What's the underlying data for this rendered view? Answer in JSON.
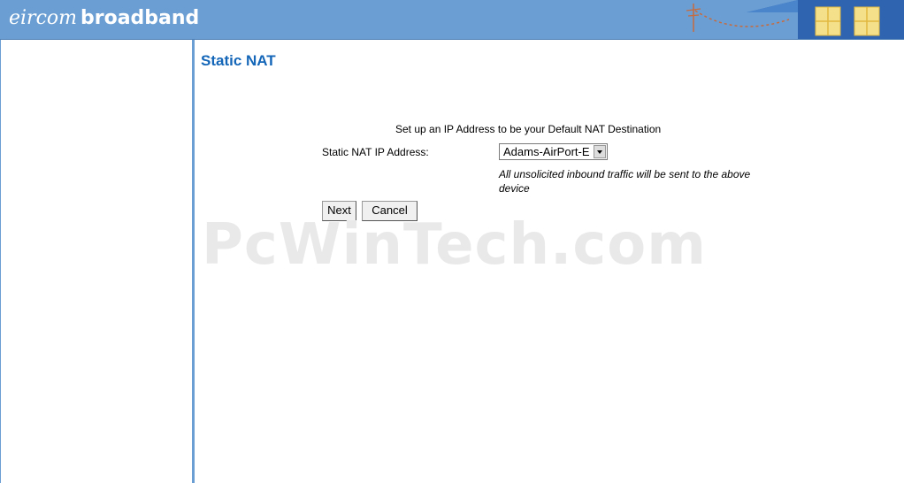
{
  "header": {
    "brand_part1": "eircom",
    "brand_part2": "broadband"
  },
  "page": {
    "title": "Static NAT",
    "intro": "Set up an IP Address to be your Default NAT Destination",
    "field_label": "Static NAT IP Address:",
    "select_value": "Adams-AirPort-E",
    "note": "All unsolicited inbound traffic will be sent to the above device",
    "next_label": "Next",
    "cancel_label": "Cancel"
  },
  "watermark": "PcWinTech.com",
  "colors": {
    "header_bg": "#6b9fd3",
    "title_color": "#1466b8"
  }
}
